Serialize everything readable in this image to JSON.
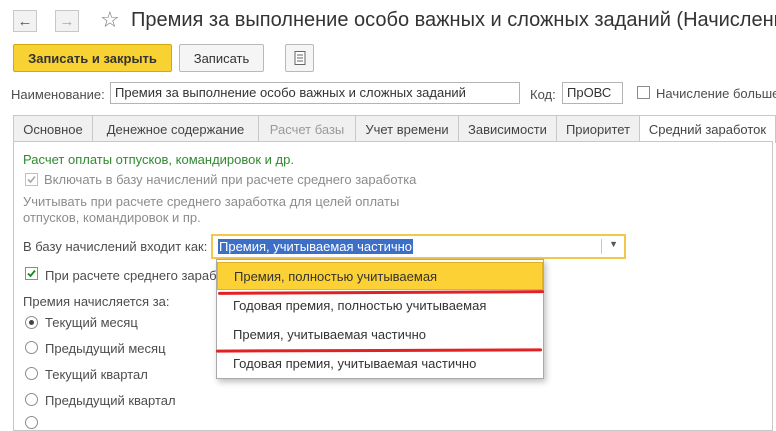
{
  "window": {
    "title": "Премия за выполнение особо важных и сложных заданий (Начисление)",
    "back_icon": "arrow-left-icon",
    "forward_icon": "arrow-right-icon",
    "favorite_icon": "star-icon"
  },
  "toolbar": {
    "save_close_label": "Записать и закрыть",
    "save_label": "Записать",
    "menu_icon": "document-list-icon"
  },
  "fields": {
    "name_label": "Наименование:",
    "name_value": "Премия за выполнение особо важных и сложных заданий",
    "code_label": "Код:",
    "code_value": "ПрОВС",
    "extra_checkbox_label": "Начисление больше"
  },
  "tabs": [
    {
      "label": "Основное",
      "state": "normal"
    },
    {
      "label": "Денежное содержание",
      "state": "normal"
    },
    {
      "label": "Расчет базы",
      "state": "disabled"
    },
    {
      "label": "Учет времени",
      "state": "normal"
    },
    {
      "label": "Зависимости",
      "state": "normal"
    },
    {
      "label": "Приоритет",
      "state": "normal"
    },
    {
      "label": "Средний заработок",
      "state": "active"
    }
  ],
  "panel": {
    "section_title": "Расчет оплаты отпусков, командировок и др.",
    "include_checkbox_label": "Включать в базу начислений при расчете среднего заработка",
    "note_line1": "Учитывать при расчете среднего заработка для целей оплаты",
    "note_line2": "отпусков, командировок и пр.",
    "base_label": "В базу начислений входит как:",
    "base_value": "Премия, учитываемая частично",
    "avg_checkbox_label": "При расчете среднего зараб",
    "period_label": "Премия начисляется за:",
    "radios": [
      {
        "label": "Текущий месяц",
        "checked": true
      },
      {
        "label": "Предыдущий месяц",
        "checked": false
      },
      {
        "label": "Текущий квартал",
        "checked": false
      },
      {
        "label": "Предыдущий квартал",
        "checked": false
      }
    ]
  },
  "dropdown": {
    "options": [
      "Премия, полностью учитываемая",
      "Годовая премия, полностью учитываемая",
      "Премия, учитываемая частично",
      "Годовая премия, учитываемая частично"
    ],
    "selected_index": 0
  },
  "colors": {
    "accent": "#f8d232",
    "section_title": "#2e8b2e",
    "selection": "#3d6fc7",
    "annotation": "#e22222"
  }
}
